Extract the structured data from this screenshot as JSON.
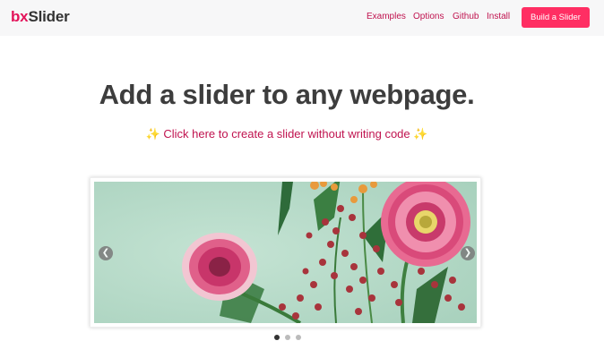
{
  "brand": {
    "prefix": "bx",
    "suffix": "Slider"
  },
  "nav": {
    "links": [
      "Examples",
      "Options",
      "Github",
      "Install"
    ],
    "cta": "Build a Slider"
  },
  "hero": {
    "title": "Add a slider to any webpage.",
    "link": "Click here to create a slider without writing code",
    "sparkle": "✨"
  },
  "slider": {
    "image": "pink-gerbera-flowers-with-red-berries",
    "prev_icon": "chevron-left-icon",
    "next_icon": "chevron-right-icon",
    "pager": {
      "total": 3,
      "active": 1
    }
  },
  "colors": {
    "accent": "#e3135a",
    "link": "#c0134f",
    "button": "#ff2e63",
    "slide_bg": "#b8dcca"
  }
}
